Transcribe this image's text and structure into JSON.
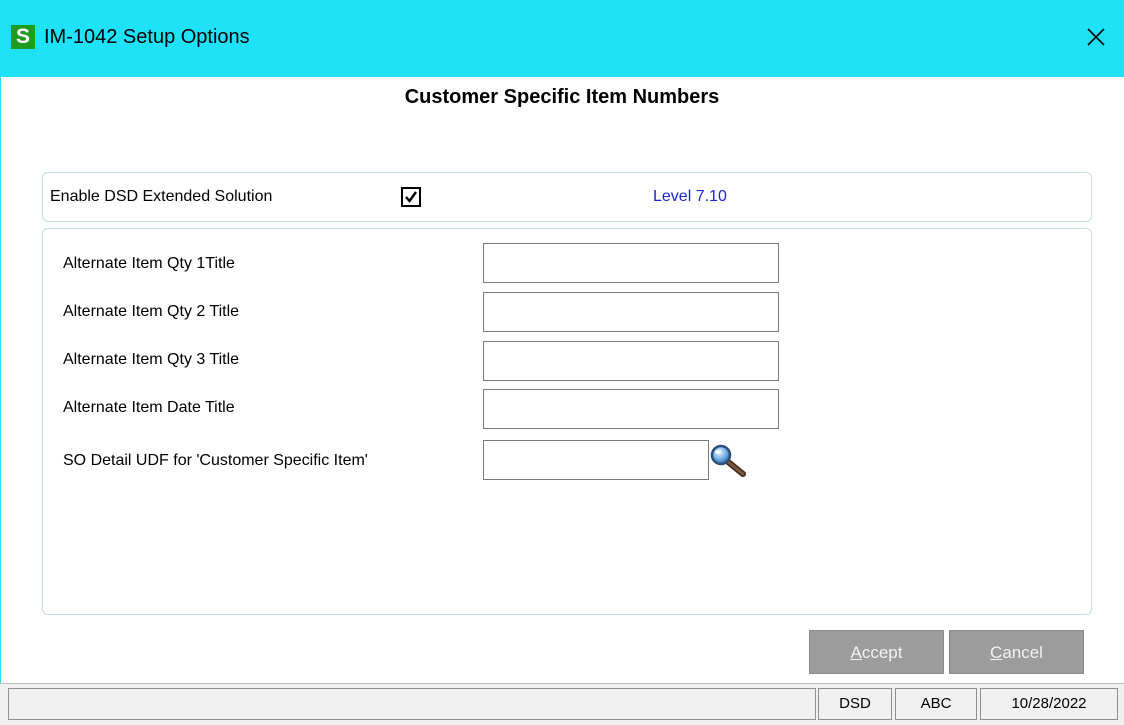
{
  "window": {
    "app_icon_letter": "S",
    "title": "IM-1042 Setup Options",
    "close_glyph": "✕"
  },
  "heading": "Customer Specific Item Numbers",
  "enable": {
    "label": "Enable DSD Extended Solution",
    "checked": true,
    "check_glyph": "✔",
    "level": "Level  7.10"
  },
  "fields": [
    {
      "label": "Alternate Item Qty 1Title",
      "value": ""
    },
    {
      "label": "Alternate Item Qty 2 Title",
      "value": ""
    },
    {
      "label": "Alternate Item Qty 3 Title",
      "value": ""
    },
    {
      "label": "Alternate Item Date Title",
      "value": ""
    },
    {
      "label": "SO Detail UDF for 'Customer Specific Item'",
      "value": "",
      "icon": "search-icon"
    }
  ],
  "buttons": {
    "accept_key": "A",
    "accept_rest": "ccept",
    "cancel_key": "C",
    "cancel_rest": "ancel"
  },
  "status": {
    "message": "",
    "module": "DSD",
    "company": "ABC",
    "date": "10/28/2022"
  },
  "colors": {
    "titlebar": "#1ee3f8",
    "app_icon": "#1e9c1e",
    "level_text": "#1d27d6",
    "button_disabled": "#9c9c9c"
  }
}
